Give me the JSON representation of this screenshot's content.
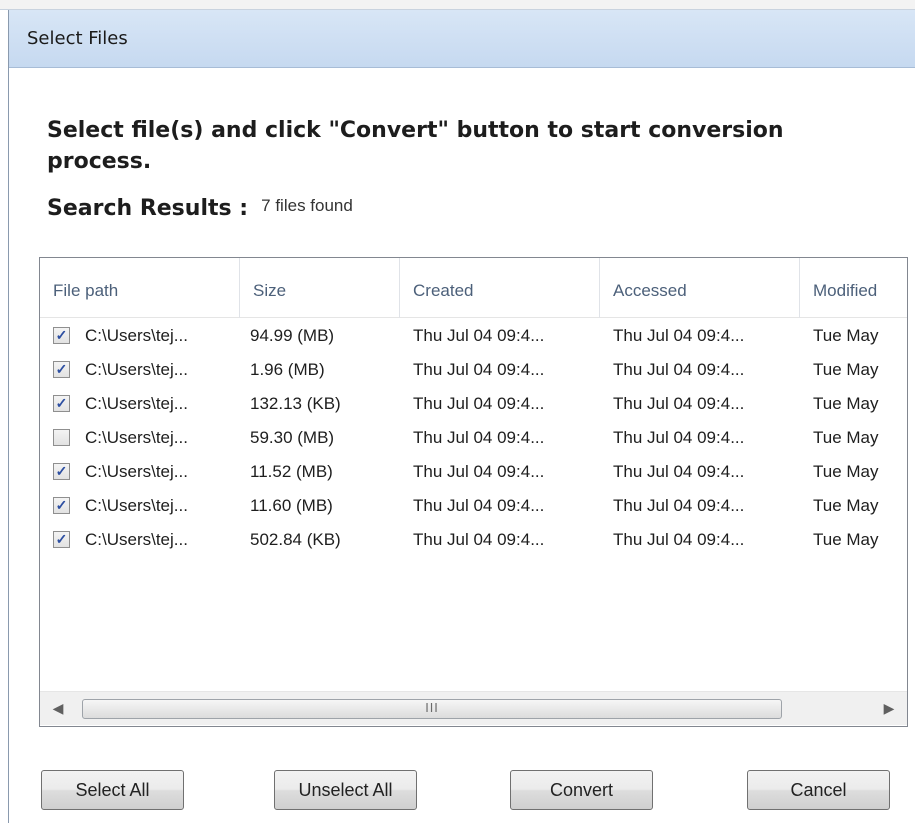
{
  "window": {
    "title": "Select Files"
  },
  "instructions": "Select file(s) and click \"Convert\" button to start conversion process.",
  "search": {
    "label": "Search Results :",
    "count_text": "7 files found"
  },
  "columns": [
    "File path",
    "Size",
    "Created",
    "Accessed",
    "Modified"
  ],
  "rows": [
    {
      "checked": true,
      "path": "C:\\Users\\tej...",
      "size": "94.99 (MB)",
      "created": "Thu Jul 04 09:4...",
      "accessed": "Thu Jul 04 09:4...",
      "modified": "Tue May"
    },
    {
      "checked": true,
      "path": "C:\\Users\\tej...",
      "size": "1.96 (MB)",
      "created": "Thu Jul 04 09:4...",
      "accessed": "Thu Jul 04 09:4...",
      "modified": "Tue May"
    },
    {
      "checked": true,
      "path": "C:\\Users\\tej...",
      "size": "132.13 (KB)",
      "created": "Thu Jul 04 09:4...",
      "accessed": "Thu Jul 04 09:4...",
      "modified": "Tue May"
    },
    {
      "checked": false,
      "path": "C:\\Users\\tej...",
      "size": "59.30 (MB)",
      "created": "Thu Jul 04 09:4...",
      "accessed": "Thu Jul 04 09:4...",
      "modified": "Tue May"
    },
    {
      "checked": true,
      "path": "C:\\Users\\tej...",
      "size": "11.52 (MB)",
      "created": "Thu Jul 04 09:4...",
      "accessed": "Thu Jul 04 09:4...",
      "modified": "Tue May"
    },
    {
      "checked": true,
      "path": "C:\\Users\\tej...",
      "size": "11.60 (MB)",
      "created": "Thu Jul 04 09:4...",
      "accessed": "Thu Jul 04 09:4...",
      "modified": "Tue May"
    },
    {
      "checked": true,
      "path": "C:\\Users\\tej...",
      "size": "502.84 (KB)",
      "created": "Thu Jul 04 09:4...",
      "accessed": "Thu Jul 04 09:4...",
      "modified": "Tue May"
    }
  ],
  "scrollbar": {
    "thumb_grip": "III"
  },
  "buttons": {
    "select_all": "Select All",
    "unselect_all": "Unselect All",
    "convert": "Convert",
    "cancel": "Cancel"
  }
}
